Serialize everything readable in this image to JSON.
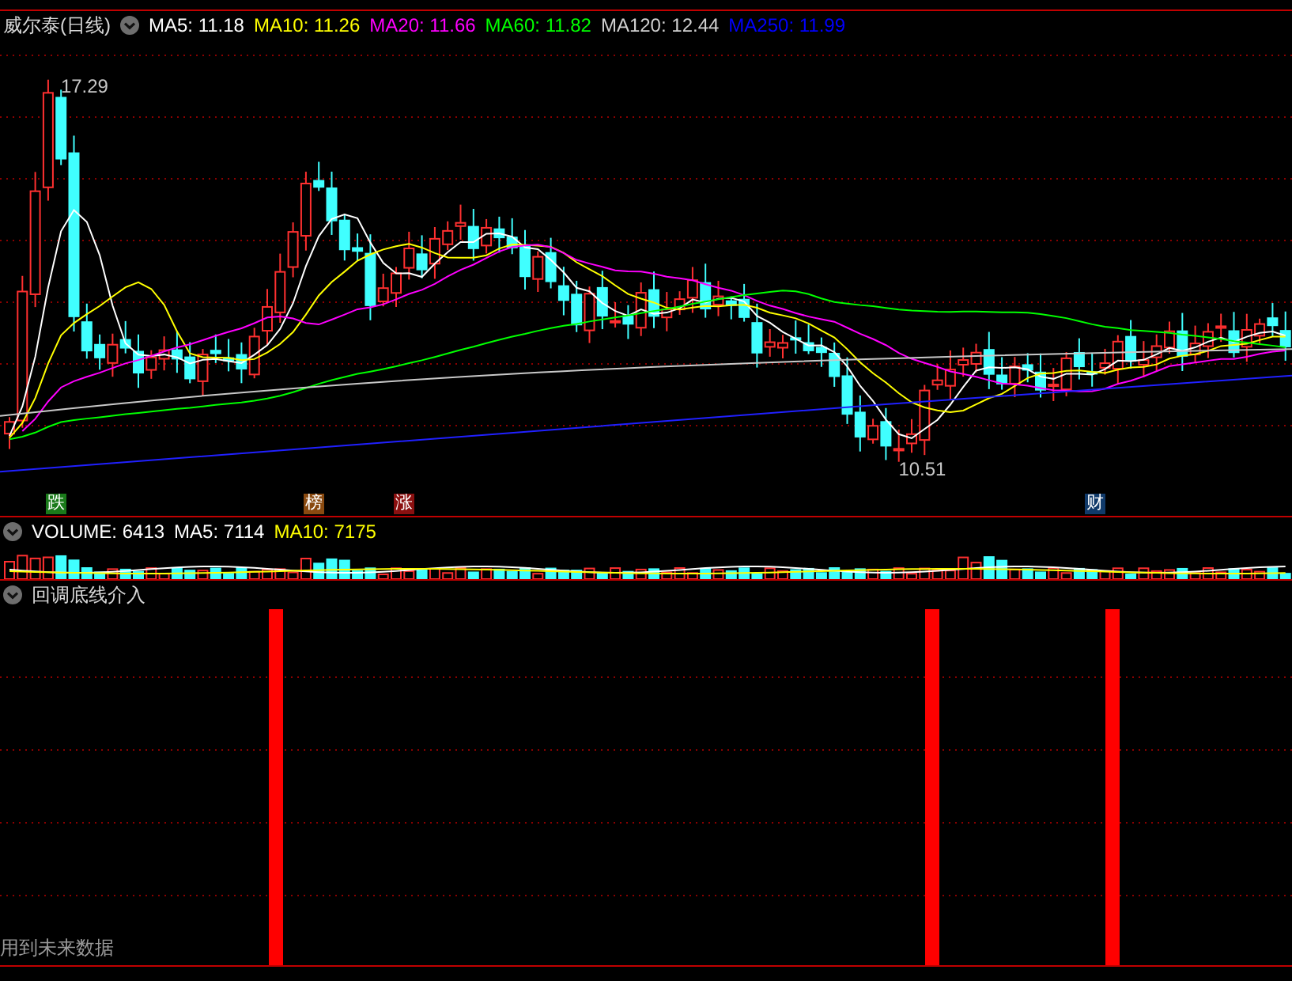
{
  "price_panel": {
    "title": "威尔泰(日线)",
    "ma_legend": [
      {
        "label": "MA5: 11.18",
        "color": "#ffffff"
      },
      {
        "label": "MA10: 11.26",
        "color": "#ffff00"
      },
      {
        "label": "MA20: 11.66",
        "color": "#ff00ff"
      },
      {
        "label": "MA60: 11.82",
        "color": "#00ff00"
      },
      {
        "label": "MA120: 12.44",
        "color": "#d0d0d0"
      },
      {
        "label": "MA250: 11.99",
        "color": "#0000ff"
      }
    ],
    "high_label": "17.29",
    "low_label": "10.51",
    "markers": [
      {
        "text": "跌",
        "color": "#1a7a1a"
      },
      {
        "text": "榜",
        "color": "#8a4a10"
      },
      {
        "text": "涨",
        "color": "#8a1010"
      },
      {
        "text": "财",
        "color": "#103a6a"
      }
    ]
  },
  "volume_panel": {
    "legend": [
      {
        "label": "VOLUME: 6413",
        "color": "#ffffff"
      },
      {
        "label": "MA5: 7114",
        "color": "#ffffff"
      },
      {
        "label": "MA10: 7175",
        "color": "#ffff00"
      }
    ]
  },
  "indicator_panel": {
    "title": "回调底线介入",
    "footnote": "用到未来数据"
  }
}
